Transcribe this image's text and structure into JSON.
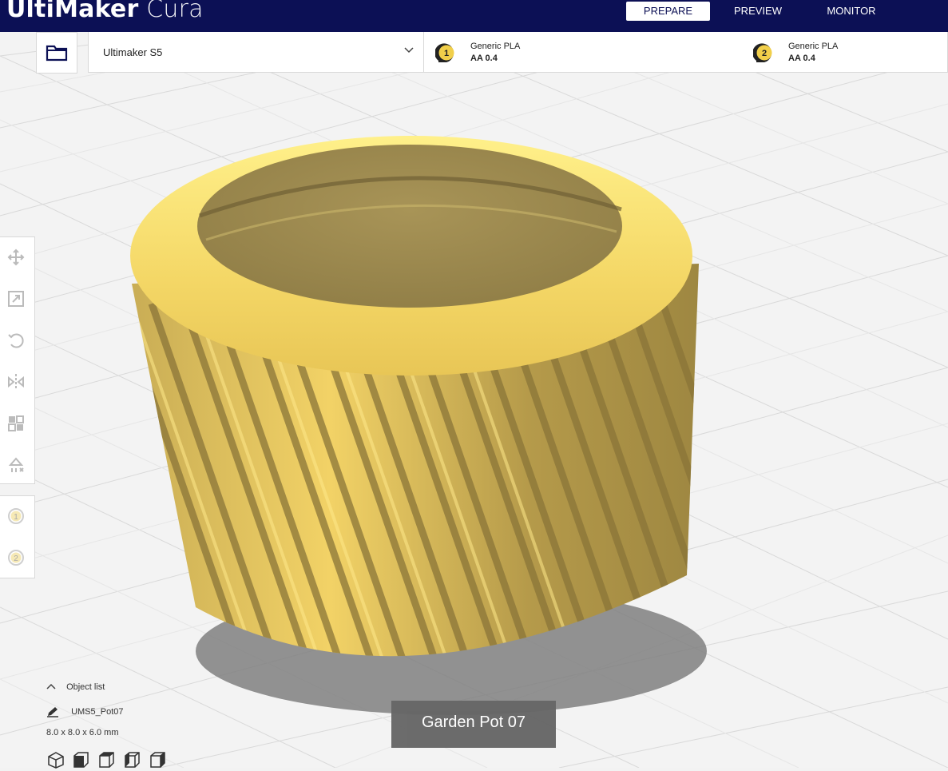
{
  "app": {
    "brand_bold": "UltiMaker",
    "brand_light": "Cura"
  },
  "stages": [
    {
      "label": "PREPARE",
      "active": true
    },
    {
      "label": "PREVIEW",
      "active": false
    },
    {
      "label": "MONITOR",
      "active": false
    }
  ],
  "machine": {
    "name": "Ultimaker S5"
  },
  "extruders": [
    {
      "number": "1",
      "material": "Generic PLA",
      "nozzle": "AA 0.4",
      "color": "#f1cf4a"
    },
    {
      "number": "2",
      "material": "Generic PLA",
      "nozzle": "AA 0.4",
      "color": "#f1cf4a"
    }
  ],
  "tools": [
    "move-icon",
    "scale-icon",
    "rotate-icon",
    "mirror-icon",
    "per-model-settings-icon",
    "support-blocker-icon"
  ],
  "extruder_tools": [
    "1",
    "2"
  ],
  "object_list": {
    "header": "Object list",
    "object_name": "UMS5_Pot07",
    "dimensions": "8.0 x 8.0 x 6.0 mm",
    "view_buttons": [
      "view-3d-icon",
      "view-front-icon",
      "view-top-icon",
      "view-left-icon",
      "view-right-icon"
    ]
  },
  "model": {
    "tooltip": "Garden Pot 07",
    "color": "#f3d46b"
  },
  "colors": {
    "header": "#0c1055",
    "accent": "#0c1055"
  }
}
